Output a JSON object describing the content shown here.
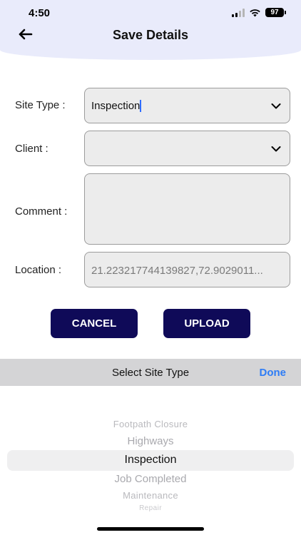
{
  "status_bar": {
    "time": "4:50",
    "battery": "97"
  },
  "header": {
    "title": "Save Details"
  },
  "form": {
    "site_type": {
      "label": "Site Type :",
      "value": "Inspection"
    },
    "client": {
      "label": "Client :",
      "value": ""
    },
    "comment": {
      "label": "Comment :",
      "value": ""
    },
    "location": {
      "label": "Location :",
      "value": "21.223217744139827,72.9029011..."
    }
  },
  "actions": {
    "cancel_label": "CANCEL",
    "upload_label": "UPLOAD"
  },
  "picker": {
    "title": "Select Site Type",
    "done_label": "Done",
    "items": [
      "Footpath Closure",
      "Highways",
      "Inspection",
      "Job Completed",
      "Maintenance",
      "Repair"
    ],
    "selected": "Inspection"
  },
  "colors": {
    "header_bg": "#e9ebfb",
    "button_bg": "#0f0a58",
    "done_link": "#2d7cf6",
    "toolbar_bg": "#d4d4d6"
  }
}
